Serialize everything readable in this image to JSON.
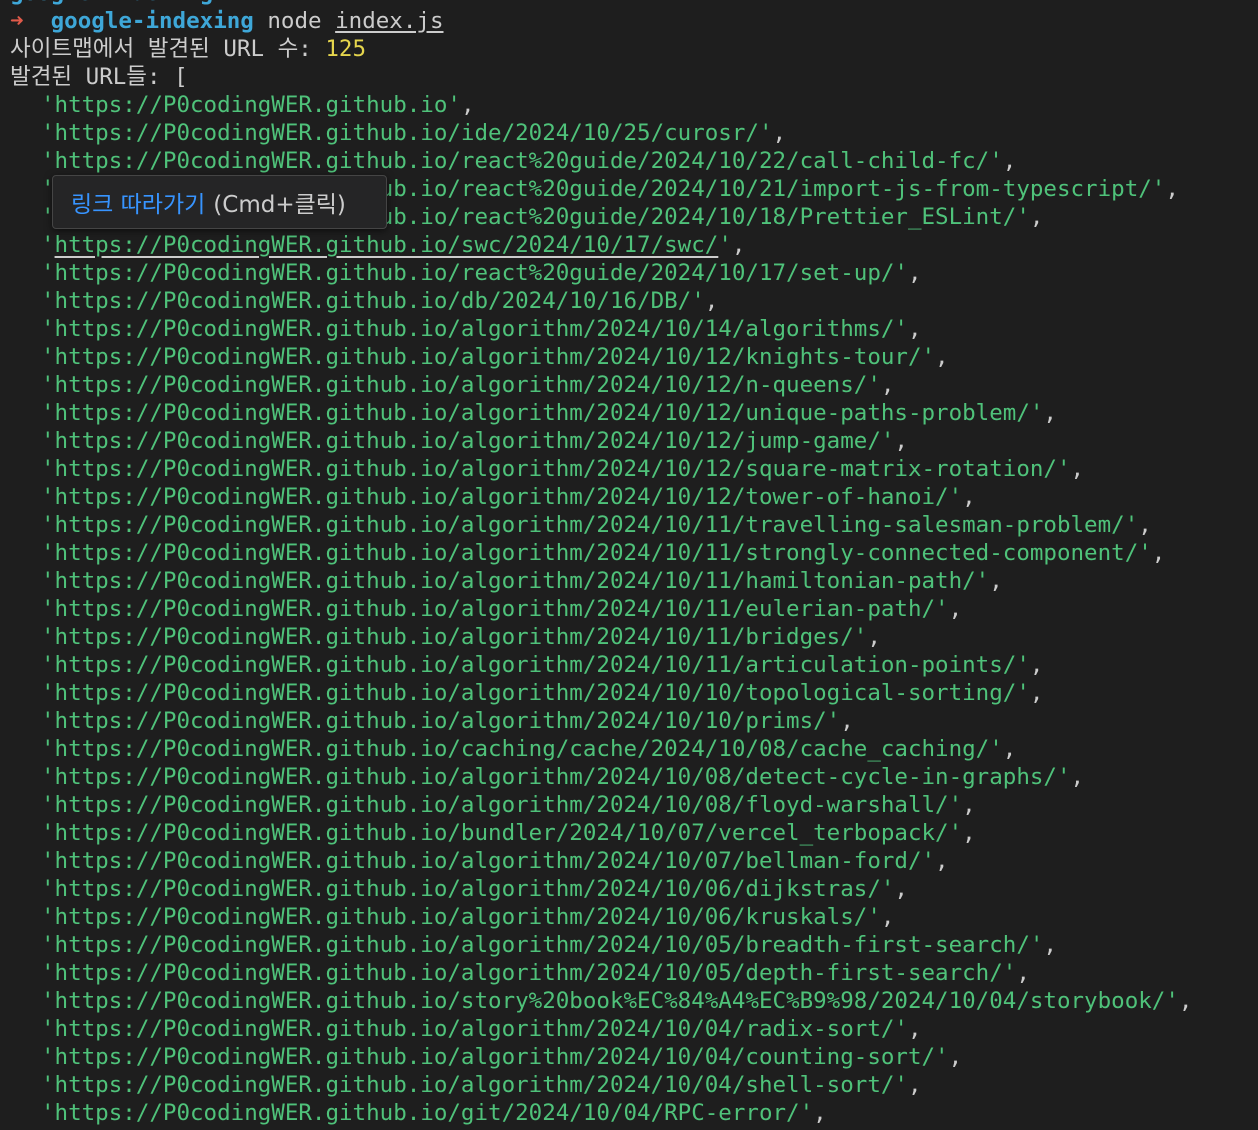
{
  "prompt": {
    "previous_dir": "google-indexing",
    "arrow": "➜",
    "dir": "google-indexing",
    "command": "node",
    "argument": "index.js"
  },
  "output": {
    "count_label": "사이트맵에서 발견된 URL 수:",
    "count_value": "125",
    "list_label": "발견된 URL들: ["
  },
  "urls": [
    "'https://P0codingWER.github.io'",
    "'https://P0codingWER.github.io/ide/2024/10/25/curosr/'",
    "'https://P0codingWER.github.io/react%20guide/2024/10/22/call-child-fc/'",
    "'https://P0codingWER.github.io/react%20guide/2024/10/21/import-js-from-typescript/'",
    "'https://P0codingWER.github.io/react%20guide/2024/10/18/Prettier_ESLint/'",
    "'https://P0codingWER.github.io/swc/2024/10/17/swc/'",
    "'https://P0codingWER.github.io/react%20guide/2024/10/17/set-up/'",
    "'https://P0codingWER.github.io/db/2024/10/16/DB/'",
    "'https://P0codingWER.github.io/algorithm/2024/10/14/algorithms/'",
    "'https://P0codingWER.github.io/algorithm/2024/10/12/knights-tour/'",
    "'https://P0codingWER.github.io/algorithm/2024/10/12/n-queens/'",
    "'https://P0codingWER.github.io/algorithm/2024/10/12/unique-paths-problem/'",
    "'https://P0codingWER.github.io/algorithm/2024/10/12/jump-game/'",
    "'https://P0codingWER.github.io/algorithm/2024/10/12/square-matrix-rotation/'",
    "'https://P0codingWER.github.io/algorithm/2024/10/12/tower-of-hanoi/'",
    "'https://P0codingWER.github.io/algorithm/2024/10/11/travelling-salesman-problem/'",
    "'https://P0codingWER.github.io/algorithm/2024/10/11/strongly-connected-component/'",
    "'https://P0codingWER.github.io/algorithm/2024/10/11/hamiltonian-path/'",
    "'https://P0codingWER.github.io/algorithm/2024/10/11/eulerian-path/'",
    "'https://P0codingWER.github.io/algorithm/2024/10/11/bridges/'",
    "'https://P0codingWER.github.io/algorithm/2024/10/11/articulation-points/'",
    "'https://P0codingWER.github.io/algorithm/2024/10/10/topological-sorting/'",
    "'https://P0codingWER.github.io/algorithm/2024/10/10/prims/'",
    "'https://P0codingWER.github.io/caching/cache/2024/10/08/cache_caching/'",
    "'https://P0codingWER.github.io/algorithm/2024/10/08/detect-cycle-in-graphs/'",
    "'https://P0codingWER.github.io/algorithm/2024/10/08/floyd-warshall/'",
    "'https://P0codingWER.github.io/bundler/2024/10/07/vercel_terbopack/'",
    "'https://P0codingWER.github.io/algorithm/2024/10/07/bellman-ford/'",
    "'https://P0codingWER.github.io/algorithm/2024/10/06/dijkstras/'",
    "'https://P0codingWER.github.io/algorithm/2024/10/06/kruskals/'",
    "'https://P0codingWER.github.io/algorithm/2024/10/05/breadth-first-search/'",
    "'https://P0codingWER.github.io/algorithm/2024/10/05/depth-first-search/'",
    "'https://P0codingWER.github.io/story%20book%EC%84%A4%EC%B9%98/2024/10/04/storybook/'",
    "'https://P0codingWER.github.io/algorithm/2024/10/04/radix-sort/'",
    "'https://P0codingWER.github.io/algorithm/2024/10/04/counting-sort/'",
    "'https://P0codingWER.github.io/algorithm/2024/10/04/shell-sort/'",
    "'https://P0codingWER.github.io/git/2024/10/04/RPC-error/'"
  ],
  "separator": ",",
  "hovered_index": 5,
  "tooltip": {
    "link_label": "링크 따라가기",
    "hint": "(Cmd+클릭)"
  },
  "colors": {
    "background": "#1e1e1e",
    "url": "#4fc27a",
    "count": "#e5d54d",
    "prompt_arrow": "#e05a4a",
    "prompt_dir": "#3ea7d8",
    "tooltip_link": "#3794ff"
  }
}
